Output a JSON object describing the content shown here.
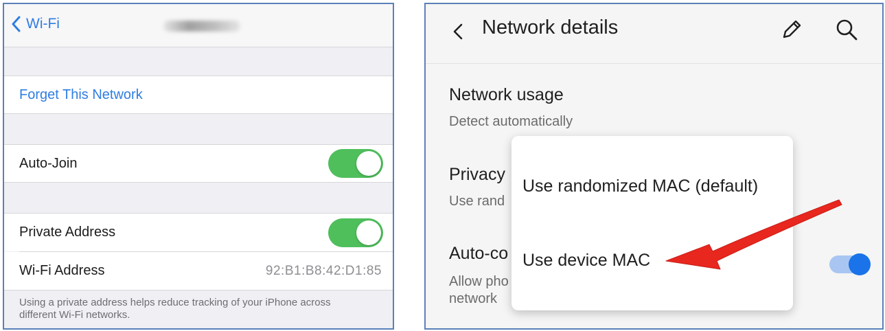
{
  "ios": {
    "back_label": "Wi-Fi",
    "forget_label": "Forget This Network",
    "auto_join_label": "Auto-Join",
    "auto_join_on": true,
    "private_address_label": "Private Address",
    "private_address_on": true,
    "wifi_address_label": "Wi-Fi Address",
    "wifi_address_value": "92:B1:B8:42:D1:85",
    "footer_text": "Using a private address helps reduce tracking of your iPhone across different Wi-Fi networks.",
    "accent_color": "#2f7de1",
    "toggle_color": "#4fbf5c"
  },
  "android": {
    "title": "Network details",
    "icons": [
      "back-arrow-icon",
      "pencil-icon",
      "search-icon"
    ],
    "network_usage_title": "Network usage",
    "network_usage_sub": "Detect automatically",
    "privacy_title": "Privacy",
    "privacy_sub": "Use rand",
    "autoconnect_title": "Auto-co",
    "autoconnect_sub_1": "Allow pho",
    "autoconnect_sub_2": "network",
    "autoconnect_on": true,
    "menu": {
      "options": [
        "Use randomized MAC (default)",
        "Use device MAC"
      ],
      "highlighted": "Use device MAC"
    },
    "switch_color": "#1a73e8",
    "arrow_color": "#e8271f"
  }
}
